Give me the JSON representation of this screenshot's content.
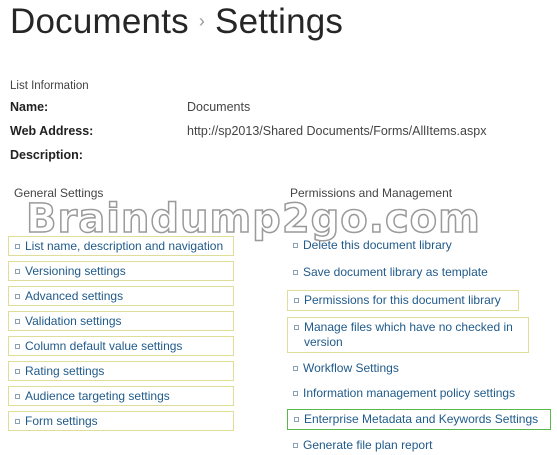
{
  "breadcrumb": {
    "parent": "Documents",
    "separator": "›",
    "current": "Settings"
  },
  "list_information": {
    "heading": "List Information",
    "fields": [
      {
        "label": "Name:",
        "value": "Documents"
      },
      {
        "label": "Web Address:",
        "value": "http://sp2013/Shared Documents/Forms/AllItems.aspx"
      },
      {
        "label": "Description:",
        "value": ""
      }
    ]
  },
  "general_settings": {
    "heading": "General Settings",
    "items": [
      "List name, description and navigation",
      "Versioning settings",
      "Advanced settings",
      "Validation settings",
      "Column default value settings",
      "Rating settings",
      "Audience targeting settings",
      "Form settings"
    ]
  },
  "permissions_management": {
    "heading": "Permissions and Management",
    "items": [
      "Delete this document library",
      "Save document library as template",
      "Permissions for this document library",
      "Manage files which have no checked in version",
      "Workflow Settings",
      "Information management policy settings",
      "Enterprise Metadata and Keywords Settings",
      "Generate file plan report"
    ]
  },
  "watermark": "Braindump2go.com",
  "colors": {
    "link": "#1f5a8a",
    "highlight_border": "#dede98",
    "selected_border": "#58b84c"
  }
}
